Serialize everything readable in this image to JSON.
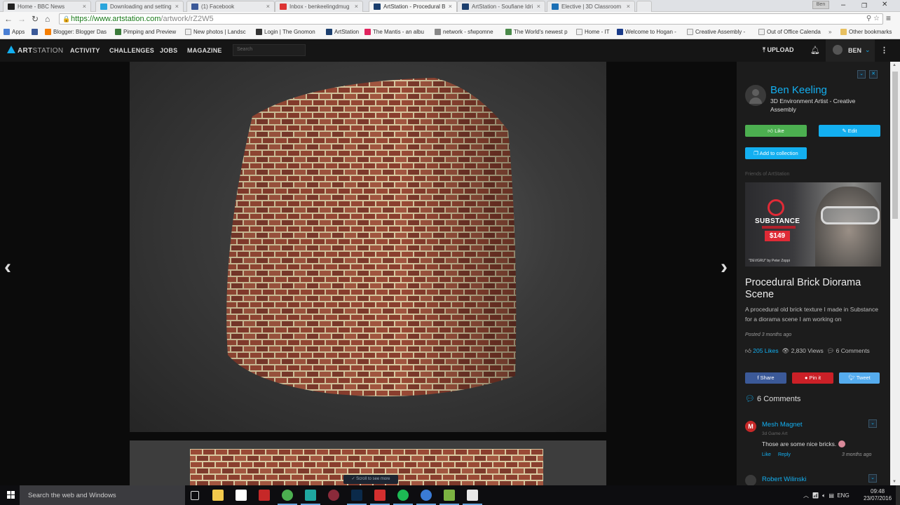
{
  "browser": {
    "tabs": [
      {
        "label": "Home - BBC News",
        "icon_color": "#222"
      },
      {
        "label": "Downloading and setting",
        "icon_color": "#2aa5dc"
      },
      {
        "label": "(1) Facebook",
        "icon_color": "#3b5998"
      },
      {
        "label": "Inbox - benkeelingdmug",
        "icon_color": "#d33"
      },
      {
        "label": "ArtStation - Procedural B",
        "icon_color": "#1c3f6e",
        "active": true
      },
      {
        "label": "ArtStation - Soufiane Idri",
        "icon_color": "#1c3f6e"
      },
      {
        "label": "Elective | 3D Classroom",
        "icon_color": "#1a6fb5"
      }
    ],
    "profile_badge": "Ben",
    "window_controls": {
      "minimize": "–",
      "restore": "❐",
      "close": "✕"
    },
    "url": {
      "scheme": "https://",
      "host": "www.artstation.com",
      "path": "/artwork/rZ2W5"
    },
    "bookmarks": [
      {
        "label": "Apps",
        "icon_color": "#4a7fd4"
      },
      {
        "label": "",
        "icon_color": "#3b5998"
      },
      {
        "label": "Blogger: Blogger Das",
        "icon_color": "#f57d00"
      },
      {
        "label": "Pimping and Preview",
        "icon_color": "#3a7a3a"
      },
      {
        "label": "New photos | Landsc",
        "icon_color": "#eee"
      },
      {
        "label": "Login | The Gnomon",
        "icon_color": "#333"
      },
      {
        "label": "ArtStation",
        "icon_color": "#1c3f6e"
      },
      {
        "label": "The Mantis - an albu",
        "icon_color": "#e0245e"
      },
      {
        "label": "network - sfwpomne",
        "icon_color": "#888"
      },
      {
        "label": "The World's newest p",
        "icon_color": "#4a8a4a"
      },
      {
        "label": "Home - IT",
        "icon_color": "#eee"
      },
      {
        "label": "Welcome to Hogan -",
        "icon_color": "#1a3b8a"
      },
      {
        "label": "Creative Assembly -",
        "icon_color": "#eee"
      },
      {
        "label": "Out of Office Calenda",
        "icon_color": "#eee"
      }
    ],
    "bookmarks_overflow": "»",
    "other_bookmarks": "Other bookmarks"
  },
  "site": {
    "logo_bold": "ART",
    "logo_light": "STATION",
    "nav": [
      "ACTIVITY",
      "CHALLENGES",
      "JOBS",
      "MAGAZINE"
    ],
    "search_placeholder": "Search",
    "upload_label": "UPLOAD",
    "user_label": "BEN"
  },
  "viewer": {
    "prev_arrow": "‹",
    "next_arrow": "›",
    "scroll_hint": "Scroll to see more"
  },
  "sidebar": {
    "artist": {
      "name": "Ben Keeling",
      "title": "3D Environment Artist - Creative Assembly"
    },
    "buttons": {
      "like": "Like",
      "edit": "Edit",
      "add_to_collection": "Add to collection"
    },
    "friends_label": "Friends of ArtStation",
    "ad": {
      "brand": "SUBSTANCE",
      "price": "$149",
      "credit": "\"DEVGRU\" by Peter Zoppi"
    },
    "artwork": {
      "title": "Procedural Brick Diorama Scene",
      "description": "A procedural old brick texture I made in Substance for a diorama scene I am working on",
      "posted": "Posted 3 months ago",
      "likes": "205 Likes",
      "views": "2,830 Views",
      "comments": "6 Comments"
    },
    "share": {
      "facebook": "Share",
      "pinterest": "Pin it",
      "twitter": "Tweet"
    },
    "comments_heading": "6 Comments",
    "comments": [
      {
        "avatar_letter": "M",
        "name": "Mesh Magnet",
        "role": "3d Game Art",
        "text": "Those are some nice bricks.",
        "like": "Like",
        "reply": "Reply",
        "time": "3 months ago"
      },
      {
        "name": "Robert Wilinski"
      }
    ]
  },
  "taskbar": {
    "search_placeholder": "Search the web and Windows",
    "apps": [
      {
        "name": "task-view",
        "color": "#0d0d10"
      },
      {
        "name": "file-explorer",
        "color": "#f2c94c"
      },
      {
        "name": "store",
        "color": "#ffffff"
      },
      {
        "name": "substance-painter",
        "color": "#c62828"
      },
      {
        "name": "chrome",
        "color": "#4caf50",
        "active": true
      },
      {
        "name": "maya",
        "color": "#1fa7a0",
        "active": true
      },
      {
        "name": "marmoset",
        "color": "#8a2a3a"
      },
      {
        "name": "photoshop",
        "color": "#0b2a4a",
        "active": true
      },
      {
        "name": "substance-designer",
        "color": "#d32f2f",
        "active": true
      },
      {
        "name": "spotify",
        "color": "#1db954",
        "active": true
      },
      {
        "name": "chrome-profile",
        "color": "#3a7bd5",
        "active": true
      },
      {
        "name": "camtasia-green",
        "color": "#7cb342",
        "active": true
      },
      {
        "name": "camtasia",
        "color": "#e8e8e8",
        "active": true
      }
    ],
    "tray": {
      "language": "ENG",
      "time": "09:48",
      "date": "23/07/2016"
    }
  }
}
